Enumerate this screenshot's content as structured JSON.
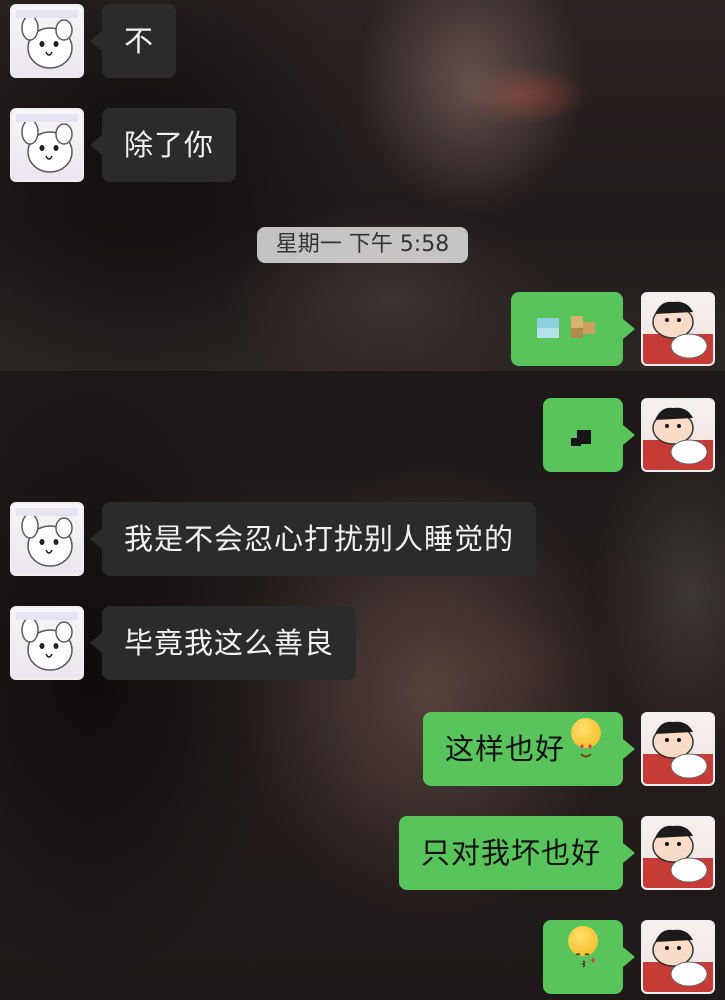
{
  "colors": {
    "incoming_bubble": "#2b2b2b",
    "outgoing_bubble": "#58c45b",
    "timestamp_bg": "#e1e1e1"
  },
  "icons": {
    "friend_avatar": "cartoon-dog-avatar-icon",
    "self_avatar": "cartoon-boy-avatar-icon",
    "heart_eyes": "heart-eyes-emoji-icon",
    "kiss": "kissing-face-emoji-icon"
  },
  "chat": {
    "timestamp": "星期一 下午 5:58",
    "messages": [
      {
        "side": "incoming",
        "text": "不"
      },
      {
        "side": "incoming",
        "text": "除了你"
      },
      {
        "side": "outgoing",
        "text": "",
        "sticker": "pixelated-sticker"
      },
      {
        "side": "outgoing",
        "text": "",
        "sticker": "pixelated-sticker"
      },
      {
        "side": "incoming",
        "text": "我是不会忍心打扰别人睡觉的"
      },
      {
        "side": "incoming",
        "text": "毕竟我这么善良"
      },
      {
        "side": "outgoing",
        "text": "这样也好",
        "emoji": "heart-eyes"
      },
      {
        "side": "outgoing",
        "text": "只对我坏也好"
      },
      {
        "side": "outgoing",
        "text": "",
        "emoji": "kiss"
      }
    ]
  }
}
